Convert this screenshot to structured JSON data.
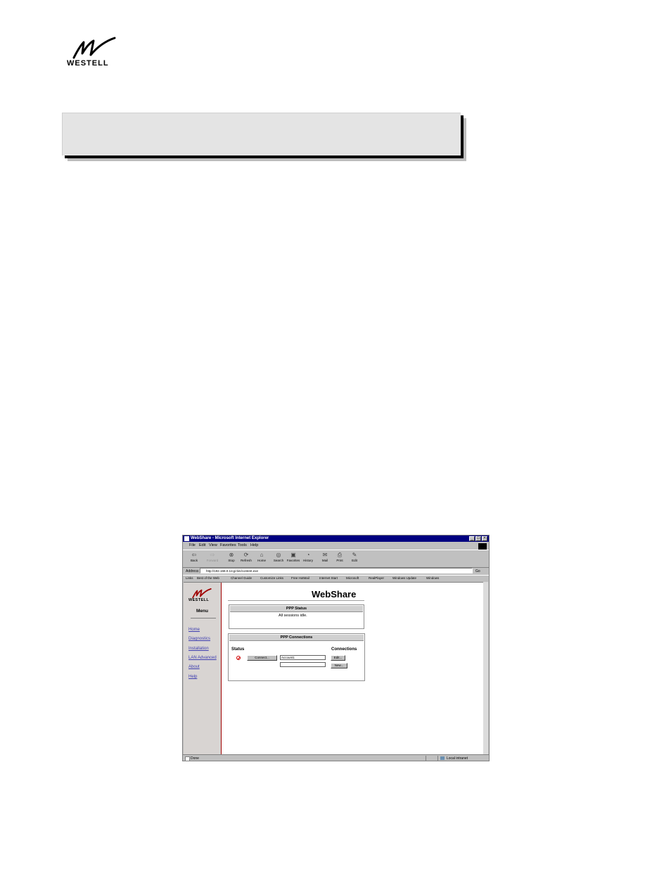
{
  "page": {
    "logo_text": "WESTELL"
  },
  "window": {
    "title": "WebShare - Microsoft Internet Explorer",
    "menu": [
      "File",
      "Edit",
      "View",
      "Favorites",
      "Tools",
      "Help"
    ],
    "toolbar": [
      "Back",
      "Forward",
      "Stop",
      "Refresh",
      "Home",
      "Search",
      "Favorites",
      "History",
      "Mail",
      "Print",
      "Edit"
    ],
    "address_label": "Address",
    "address_url": "http://192.168.0.1/cgi-bin/content.exe",
    "go_label": "Go",
    "links_label": "Links",
    "links": [
      "Best of the Web",
      "Channel Guide",
      "Customize Links",
      "Free HotMail",
      "Internet Start",
      "Microsoft",
      "RealPlayer",
      "Windows Update",
      "Windows"
    ],
    "status_text": "Done",
    "zone_text": "Local intranet"
  },
  "webshare": {
    "logo_text": "WESTELL",
    "menu_heading": "Menu",
    "nav": [
      "Home",
      "Diagnostics",
      "Installation",
      "LAN Advanced",
      "About",
      "Help"
    ],
    "title": "WebShare",
    "ppp_status": {
      "heading": "PPP Status",
      "message": "All sessions idle."
    },
    "ppp_connections": {
      "heading": "PPP Connections",
      "status_label": "Status",
      "connections_label": "Connections",
      "connect_button": "Connect...",
      "account_value": "Account1",
      "second_value": "",
      "edit_button": "Edit...",
      "new_button": "New..."
    }
  }
}
